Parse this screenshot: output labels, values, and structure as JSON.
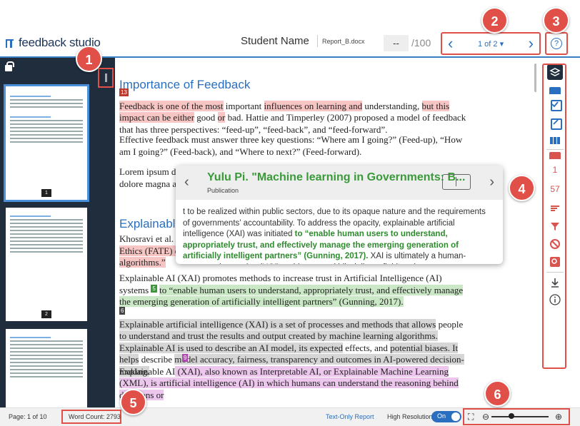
{
  "header": {
    "logo_text": "feedback studio",
    "student_name": "Student Name",
    "document_name": "Report_B.docx",
    "score_value": "--",
    "score_max": "/100",
    "pager_label": "1 of 2 ▾",
    "pager_prev": "‹",
    "pager_next": "›",
    "help_icon": "?"
  },
  "callouts": [
    "1",
    "2",
    "3",
    "4",
    "5",
    "6"
  ],
  "thumbnails": [
    {
      "page": "1",
      "active": true
    },
    {
      "page": "2",
      "active": false
    },
    {
      "page": "",
      "active": false
    }
  ],
  "document": {
    "heading1": "Importance of Feedback",
    "tag13": "13",
    "p1_a": "Feedback is one of the most",
    "p1_b": " important ",
    "p1_c": "influences on learning and",
    "p1_d": " understanding, ",
    "p1_e": "but this impact can be either",
    "p1_f": " good ",
    "p1_g": "or",
    "p1_h": " bad. Hattie and Timperley (2007) proposed a model of feedback that has three perspectives: “feed-up”, “feed-back”, and “feed-forward”.",
    "p2": "Effective feedback must answer three key questions: “Where am I going?” (Feed-up), “How am I going?” (Feed-back), and “Where to next?” (Feed-forward).",
    "p3_line1": "Lorem ipsum do",
    "p3_line2": "dolore magna ali",
    "heading2": "Explainable",
    "p4_line1": "Khosravi et al. (2",
    "p4_line2": "Ethics (FATE) of e",
    "p4_line3": "algorithms.”",
    "tag5": "5",
    "p5_a": "Explainable AI (XAI) promotes methods to increase trust in Artificial Intelligence (AI) systems ",
    "p5_b": "to “enable human users to understand, appropriately trust, and effectively manage the emerging generation of artificially intelligent partners” (Gunning, 2017).",
    "tag6": "6",
    "p6_a": "Explainable artificial intelligence (XAI) is a set of processes and methods that allows",
    "p6_b": " people ",
    "p6_c": "to understand and trust the results and output created by machine learning algorithms. Explainable AI is used to describe an AI model, its expected",
    "p6_d": " effects, and ",
    "p6_e": "potential biases. It helps",
    "p6_f": " describe ",
    "p6_g": "model accuracy, fairness, transparency and outcomes in AI-powered decision-making.",
    "tag9": "9",
    "p7_a": "Explainable AI",
    "p7_b": " (XAI), also known as Interpretable AI, or Explainable Machine Learning (XML), is artificial intelligence (AI) in which humans can understand the reasoning behind decisions or"
  },
  "popup": {
    "title": "Yulu Pi. \"Machine learning in Governments: B...",
    "subtitle": "Publication",
    "body_a": "t to be realized within public sectors, due to its opaque nature and the requirements of governments’ accountability. To address the opacity, explainable artificial intelligence (XAI) was initiated ",
    "body_b": "to “enable human users to understand, appropriately trust, and effectively manage the emerging generation of artificially intelligent partners” (Gunning, 2017).",
    "body_c": " XAI is ultimately a human-computer interaction (HCI) problem, a multidisciplinary field on the",
    "prev": "‹",
    "next": "›"
  },
  "toolbar": {
    "flag_count": "1",
    "similarity_score": "57"
  },
  "footer": {
    "page_info": "Page: 1 of 10",
    "word_count": "Word Count: 2793",
    "text_only": "Text-Only Report",
    "high_res_label": "High Resolution",
    "toggle_label": "On",
    "zoom_out": "⊖",
    "zoom_in": "⊕",
    "fit_icon": "⛶"
  },
  "colors": {
    "accent": "#2a6fbf",
    "callout": "#e05048",
    "highlight_red": "#f7c6c4",
    "highlight_green": "#cbe8c6",
    "highlight_grey": "#d6d6d6",
    "highlight_pink": "#ecc6ec"
  }
}
